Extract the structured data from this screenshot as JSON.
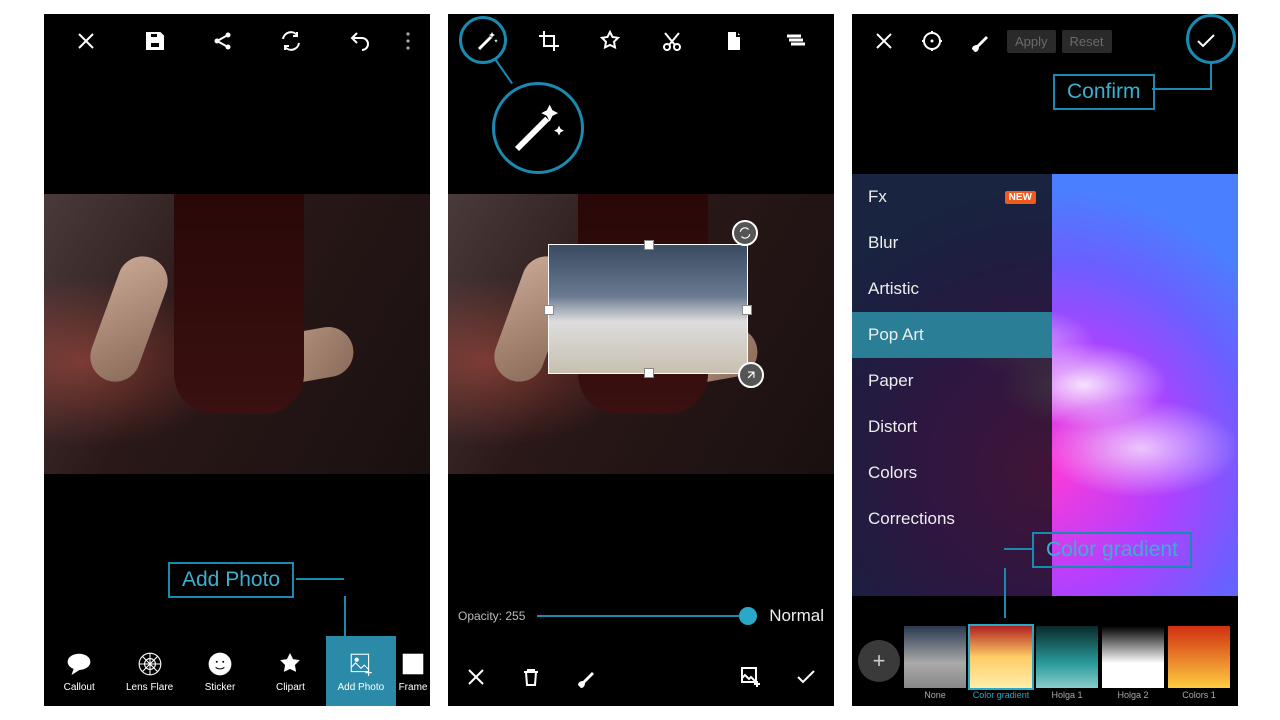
{
  "accent": "#1a8ab0",
  "panel1": {
    "annot": "Add Photo",
    "tools": [
      {
        "label": "Callout"
      },
      {
        "label": "Lens Flare"
      },
      {
        "label": "Sticker"
      },
      {
        "label": "Clipart"
      },
      {
        "label": "Add Photo"
      },
      {
        "label": "Frame"
      }
    ]
  },
  "panel2": {
    "opacity_label": "Opacity: 255",
    "blend_mode": "Normal"
  },
  "panel3": {
    "apply": "Apply",
    "reset": "Reset",
    "annot_confirm": "Confirm",
    "annot_grad": "Color gradient",
    "fx": [
      {
        "label": "Fx",
        "new": true
      },
      {
        "label": "Blur"
      },
      {
        "label": "Artistic"
      },
      {
        "label": "Pop Art",
        "sel": true
      },
      {
        "label": "Paper"
      },
      {
        "label": "Distort"
      },
      {
        "label": "Colors"
      },
      {
        "label": "Corrections"
      }
    ],
    "new_badge": "NEW",
    "presets": [
      {
        "label": "None"
      },
      {
        "label": "Color gradient",
        "sel": true
      },
      {
        "label": "Holga 1"
      },
      {
        "label": "Holga 2"
      },
      {
        "label": "Colors 1"
      }
    ]
  }
}
